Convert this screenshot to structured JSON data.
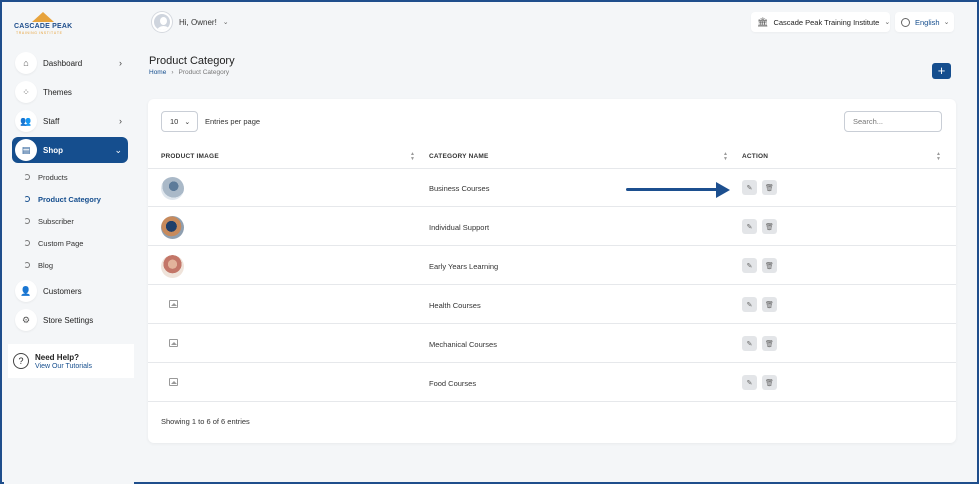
{
  "brand": {
    "name": "CASCADE PEAK",
    "tagline": "TRAINING INSTITUTE",
    "accent": "#154e8e",
    "logo_color": "#e7a33c"
  },
  "topbar": {
    "greeting": "Hi, Owner!",
    "institute": "Cascade Peak Training Institute",
    "language": "English"
  },
  "sidebar": {
    "items": [
      {
        "label": "Dashboard",
        "icon": "home-icon",
        "has_children": true
      },
      {
        "label": "Themes",
        "icon": "themes-icon",
        "has_children": false
      },
      {
        "label": "Staff",
        "icon": "staff-icon",
        "has_children": true
      },
      {
        "label": "Shop",
        "icon": "shop-icon",
        "has_children": true,
        "active": true
      }
    ],
    "shop_children": [
      "Products",
      "Product Category",
      "Subscriber",
      "Custom Page",
      "Blog"
    ],
    "bottom_items": [
      {
        "label": "Customers",
        "icon": "user-icon"
      },
      {
        "label": "Store Settings",
        "icon": "settings-icon"
      }
    ],
    "help": {
      "title": "Need Help?",
      "link": "View Our Tutorials"
    }
  },
  "page": {
    "title": "Product Category",
    "breadcrumb": [
      "Home",
      "Product Category"
    ]
  },
  "table": {
    "page_size": "10",
    "entries_label": "Entries per page",
    "search_placeholder": "Search...",
    "columns": [
      "PRODUCT IMAGE",
      "CATEGORY NAME",
      "ACTION"
    ],
    "rows": [
      {
        "name": "Business Courses",
        "image": "photo"
      },
      {
        "name": "Individual Support",
        "image": "photo"
      },
      {
        "name": "Early Years Learning",
        "image": "photo"
      },
      {
        "name": "Health Courses",
        "image": "placeholder"
      },
      {
        "name": "Mechanical Courses",
        "image": "placeholder"
      },
      {
        "name": "Food Courses",
        "image": "placeholder"
      }
    ],
    "footer": "Showing 1 to 6 of 6 entries"
  }
}
